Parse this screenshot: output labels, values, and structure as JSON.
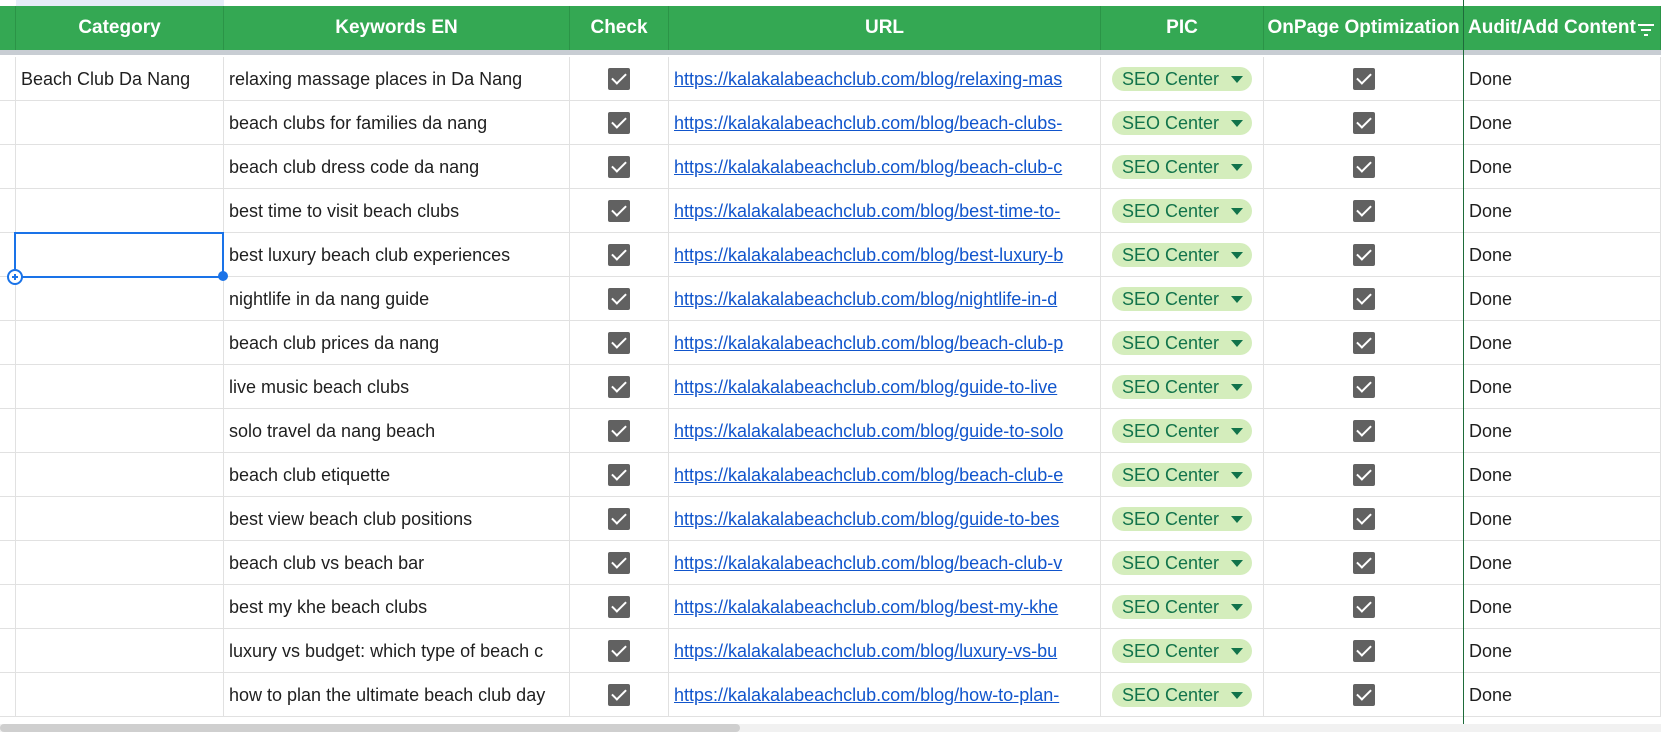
{
  "sheet": {
    "headers": {
      "category": "Category",
      "keywords": "Keywords EN",
      "check": "Check",
      "url": "URL",
      "pic": "PIC",
      "onpage": "OnPage Optimization",
      "audit": "Audit/Add Content"
    },
    "rows": [
      {
        "category": "Beach Club Da Nang",
        "keyword": "relaxing massage places in Da Nang",
        "check": true,
        "url": "https://kalakalabeachclub.com/blog/relaxing-mas",
        "pic": "SEO Center",
        "onpage": true,
        "audit": "Done"
      },
      {
        "category": "",
        "keyword": "beach clubs for families da nang",
        "check": true,
        "url": "https://kalakalabeachclub.com/blog/beach-clubs-",
        "pic": "SEO Center",
        "onpage": true,
        "audit": "Done"
      },
      {
        "category": "",
        "keyword": "beach club dress code da nang",
        "check": true,
        "url": "https://kalakalabeachclub.com/blog/beach-club-c",
        "pic": "SEO Center",
        "onpage": true,
        "audit": "Done"
      },
      {
        "category": "",
        "keyword": "best time to visit beach clubs",
        "check": true,
        "url": "https://kalakalabeachclub.com/blog/best-time-to-",
        "pic": "SEO Center",
        "onpage": true,
        "audit": "Done"
      },
      {
        "category": "",
        "keyword": "best luxury beach club experiences",
        "check": true,
        "url": "https://kalakalabeachclub.com/blog/best-luxury-b",
        "pic": "SEO Center",
        "onpage": true,
        "audit": "Done"
      },
      {
        "category": "",
        "keyword": "nightlife in da nang guide",
        "check": true,
        "url": "https://kalakalabeachclub.com/blog/nightlife-in-d",
        "pic": "SEO Center",
        "onpage": true,
        "audit": "Done"
      },
      {
        "category": "",
        "keyword": "beach club prices da nang",
        "check": true,
        "url": "https://kalakalabeachclub.com/blog/beach-club-p",
        "pic": "SEO Center",
        "onpage": true,
        "audit": "Done"
      },
      {
        "category": "",
        "keyword": "live music beach clubs",
        "check": true,
        "url": "https://kalakalabeachclub.com/blog/guide-to-live",
        "pic": "SEO Center",
        "onpage": true,
        "audit": "Done"
      },
      {
        "category": "",
        "keyword": "solo travel da nang beach",
        "check": true,
        "url": "https://kalakalabeachclub.com/blog/guide-to-solo",
        "pic": "SEO Center",
        "onpage": true,
        "audit": "Done"
      },
      {
        "category": "",
        "keyword": "beach club etiquette",
        "check": true,
        "url": "https://kalakalabeachclub.com/blog/beach-club-e",
        "pic": "SEO Center",
        "onpage": true,
        "audit": "Done"
      },
      {
        "category": "",
        "keyword": "best view beach club positions",
        "check": true,
        "url": "https://kalakalabeachclub.com/blog/guide-to-bes",
        "pic": "SEO Center",
        "onpage": true,
        "audit": "Done"
      },
      {
        "category": "",
        "keyword": "beach club vs beach bar",
        "check": true,
        "url": "https://kalakalabeachclub.com/blog/beach-club-v",
        "pic": "SEO Center",
        "onpage": true,
        "audit": "Done"
      },
      {
        "category": "",
        "keyword": "best my khe beach clubs",
        "check": true,
        "url": "https://kalakalabeachclub.com/blog/best-my-khe",
        "pic": "SEO Center",
        "onpage": true,
        "audit": "Done"
      },
      {
        "category": "",
        "keyword": "luxury vs budget: which type of beach c",
        "check": true,
        "url": "https://kalakalabeachclub.com/blog/luxury-vs-bu",
        "pic": "SEO Center",
        "onpage": true,
        "audit": "Done"
      },
      {
        "category": "",
        "keyword": "how to plan the ultimate beach club day",
        "check": true,
        "url": "https://kalakalabeachclub.com/blog/how-to-plan-",
        "pic": "SEO Center",
        "onpage": true,
        "audit": "Done"
      }
    ],
    "colors": {
      "header_bg": "#34a853",
      "chip_bg": "#d4edbc",
      "chip_text": "#11734b",
      "link": "#1155cc",
      "selection": "#1a73e8"
    }
  }
}
